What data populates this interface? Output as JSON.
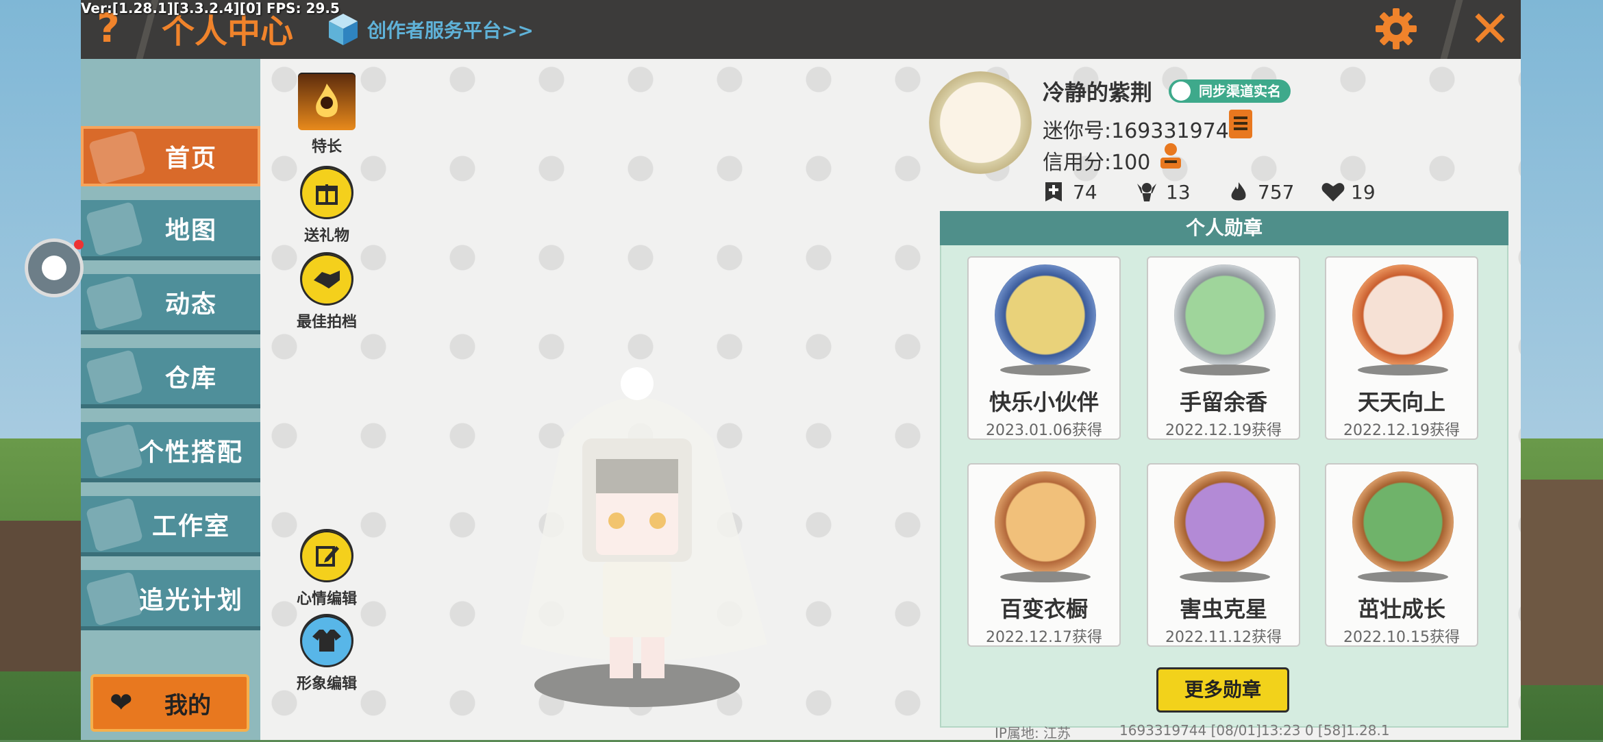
{
  "debug": {
    "text": "Ver:[1.28.1][3.3.2.4][0] FPS: 29.5"
  },
  "header": {
    "help": "?",
    "title": "个人中心",
    "creator_link": "创作者服务平台>>",
    "close": "✕"
  },
  "sidebar": {
    "items": [
      {
        "label": "首页"
      },
      {
        "label": "地图"
      },
      {
        "label": "动态"
      },
      {
        "label": "仓库"
      },
      {
        "label": "个性搭配"
      },
      {
        "label": "工作室"
      },
      {
        "label": "追光计划"
      }
    ],
    "mine_label": "我的"
  },
  "actions": [
    {
      "label": "特长"
    },
    {
      "label": "送礼物"
    },
    {
      "label": "最佳拍档"
    },
    {
      "label": "心情编辑"
    },
    {
      "label": "形象编辑"
    }
  ],
  "profile": {
    "nickname": "冷静的紫荆",
    "sync_badge": "同步渠道实名",
    "mini_id": "迷你号:1693319744",
    "credit": "信用分:100",
    "stats": [
      {
        "icon": "plus-icon",
        "value": "74"
      },
      {
        "icon": "fans-icon",
        "value": "13"
      },
      {
        "icon": "fire-icon",
        "value": "757"
      },
      {
        "icon": "heart-icon",
        "value": "19"
      }
    ]
  },
  "medals": {
    "heading": "个人勋章",
    "cards": [
      {
        "title": "快乐小伙伴",
        "date": "2023.01.06获得",
        "color": "#5a7fc0"
      },
      {
        "title": "手留余香",
        "date": "2022.12.19获得",
        "color": "#a9b0b5"
      },
      {
        "title": "天天向上",
        "date": "2022.12.19获得",
        "color": "#d9774a"
      },
      {
        "title": "百变衣橱",
        "date": "2022.12.17获得",
        "color": "#c9804c"
      },
      {
        "title": "害虫克星",
        "date": "2022.11.12获得",
        "color": "#b5713f"
      },
      {
        "title": "茁壮成长",
        "date": "2022.10.15获得",
        "color": "#b5713f"
      }
    ],
    "more": "更多勋章"
  },
  "footer": {
    "ip": "IP属地: 江苏",
    "info": "1693319744    [08/01]13:23 0  [58]1.28.1"
  }
}
